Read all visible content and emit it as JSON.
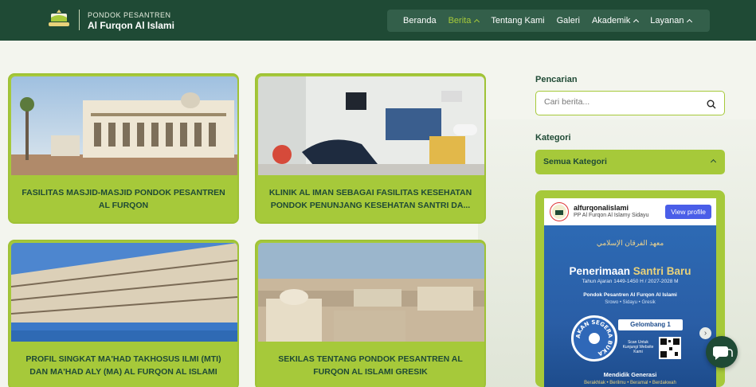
{
  "header": {
    "brand_top": "PONDOK PESANTREN",
    "brand_main": "Al Furqon Al Islami",
    "nav": [
      {
        "label": "Beranda",
        "active": false,
        "dropdown": false
      },
      {
        "label": "Berita",
        "active": true,
        "dropdown": true
      },
      {
        "label": "Tentang Kami",
        "active": false,
        "dropdown": false
      },
      {
        "label": "Galeri",
        "active": false,
        "dropdown": false
      },
      {
        "label": "Akademik",
        "active": false,
        "dropdown": true
      },
      {
        "label": "Layanan",
        "active": false,
        "dropdown": true
      }
    ]
  },
  "articles": [
    {
      "title": "FASILITAS MASJID-MASJID PONDOK PESANTREN AL FURQON"
    },
    {
      "title": "KLINIK AL IMAN SEBAGAI FASILITAS KESEHATAN PONDOK PENUNJANG KESEHATAN SANTRI DA..."
    },
    {
      "title": "PROFIL SINGKAT MA'HAD TAKHOSUS ILMI (MTI) DAN MA'HAD ALY (MA) AL FURQON AL ISLAMI"
    },
    {
      "title": "SEKILAS TENTANG PONDOK PESANTREN AL FURQON AL ISLAMI GRESIK"
    }
  ],
  "sidebar": {
    "search_label": "Pencarian",
    "search_placeholder": "Cari berita...",
    "category_label": "Kategori",
    "category_selected": "Semua Kategori"
  },
  "instagram": {
    "username": "alfurqonalislami",
    "subtitle": "PP Al Furqon Al Islamy Sidayu",
    "button": "View profile",
    "post": {
      "arabic": "معهد الفرقان الإسلامي",
      "headline_a": "Penerimaan",
      "headline_b": "Santri Baru",
      "year": "Tahun Ajaran 1449-1450 H / 2027-2028 M",
      "school": "Pondok Pesantren Al Furqon Al Islami",
      "location": "Srowo  •  Sidayu  •  Gresik",
      "stamp": "AKAN SEGERA BUKA",
      "gelombang": "Gelombang 1",
      "scan": "Scan Untuk Kunjungi Website Kami",
      "footer1": "Mendidik Generasi",
      "footer2": "Berakhlak • Berilmu • Beramal • Berdakwah"
    }
  },
  "colors": {
    "header_bg": "#1f4a35",
    "accent_green": "#a6c93a",
    "nav_bg": "#335f4a",
    "brand_blue": "#2d6ab4"
  }
}
